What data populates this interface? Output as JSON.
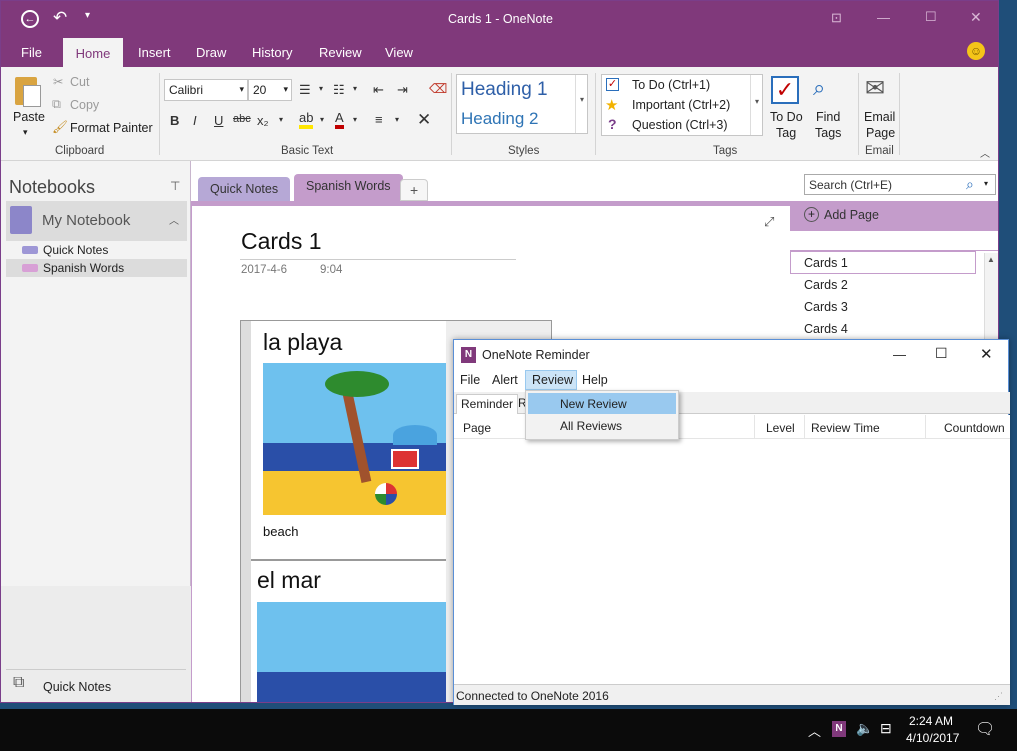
{
  "onenote": {
    "window_title": "Cards 1  -  OneNote",
    "ribbon_tabs": [
      "File",
      "Home",
      "Insert",
      "Draw",
      "History",
      "Review",
      "View"
    ],
    "clipboard": {
      "paste": "Paste",
      "cut": "Cut",
      "copy": "Copy",
      "format_painter": "Format Painter",
      "label": "Clipboard"
    },
    "basic_text": {
      "font": "Calibri",
      "size": "20",
      "bold": "B",
      "italic": "I",
      "underline": "U",
      "strike": "abc",
      "subscript": "x₂",
      "label": "Basic Text"
    },
    "styles": {
      "heading1": "Heading 1",
      "heading2": "Heading 2",
      "label": "Styles"
    },
    "tags": {
      "todo": "To Do (Ctrl+1)",
      "important": "Important (Ctrl+2)",
      "question": "Question (Ctrl+3)",
      "todo_tag": "To Do",
      "todo_tag2": "Tag",
      "find": "Find",
      "find2": "Tags",
      "label": "Tags"
    },
    "email": {
      "l1": "Email",
      "l2": "Page",
      "label": "Email"
    },
    "nav": {
      "heading": "Notebooks",
      "notebook": "My Notebook",
      "sections": [
        "Quick Notes",
        "Spanish Words"
      ],
      "footer": "Quick Notes"
    },
    "section_tabs": [
      "Quick Notes",
      "Spanish Words",
      "+"
    ],
    "search_placeholder": "Search (Ctrl+E)",
    "page": {
      "title": "Cards 1",
      "date": "2017-4-6",
      "time": "9:04"
    },
    "cards": [
      {
        "word": "la playa",
        "translation": "beach"
      },
      {
        "word": "el mar",
        "translation": ""
      }
    ],
    "add_page": "Add Page",
    "pages": [
      "Cards 1",
      "Cards 2",
      "Cards 3",
      "Cards 4"
    ]
  },
  "reminder": {
    "title": "OneNote Reminder",
    "menu": [
      "File",
      "Alert",
      "Review",
      "Help"
    ],
    "tabs": [
      "Reminder",
      "R"
    ],
    "dropdown": [
      "New Review",
      "All Reviews"
    ],
    "columns": [
      "Page",
      "Level",
      "Review Time",
      "Countdown"
    ],
    "status": "Connected to OneNote 2016"
  },
  "taskbar": {
    "time": "2:24 AM",
    "date": "4/10/2017"
  },
  "colors": {
    "accent": "#80397b",
    "section_purple": "#c49ccb",
    "section_lilac": "#b6a8d6",
    "highlight": "#99c9ef"
  }
}
